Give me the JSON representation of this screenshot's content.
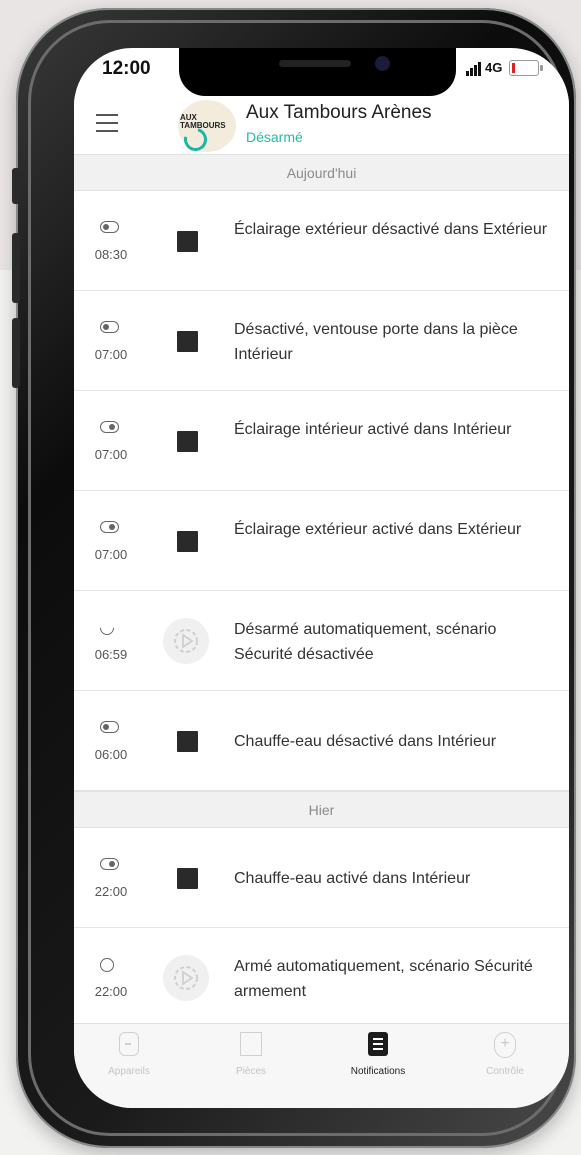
{
  "status_bar": {
    "time": "12:00",
    "network": "4G"
  },
  "header": {
    "site_name": "Aux Tambours Arènes",
    "site_status": "Désarmé",
    "logo_text": "AUX\nTAMBOURS",
    "status_color": "#23b9a7"
  },
  "sections": {
    "today": "Aujourd'hui",
    "yesterday": "Hier"
  },
  "notifications": [
    {
      "time": "08:30",
      "state_icon": "toggle-off-icon",
      "source_icon": "device-icon",
      "text": "Éclairage extérieur désactivé dans Extérieur"
    },
    {
      "time": "07:00",
      "state_icon": "toggle-off-icon",
      "source_icon": "device-icon",
      "text": "Désactivé, ventouse porte dans la pièce Intérieur"
    },
    {
      "time": "07:00",
      "state_icon": "toggle-on-icon",
      "source_icon": "device-icon",
      "text": "Éclairage intérieur activé dans Intérieur"
    },
    {
      "time": "07:00",
      "state_icon": "toggle-on-icon",
      "source_icon": "device-icon",
      "text": "Éclairage extérieur activé dans Extérieur"
    },
    {
      "time": "06:59",
      "state_icon": "disarm-icon",
      "source_icon": "scenario-gear-icon",
      "text": "Désarmé automatiquement, scénario Sécurité désactivée"
    },
    {
      "time": "06:00",
      "state_icon": "toggle-off-icon",
      "source_icon": "device-icon",
      "text": "Chauffe-eau désactivé dans Intérieur"
    },
    {
      "time": "22:00",
      "state_icon": "toggle-on-icon",
      "source_icon": "device-icon",
      "text": "Chauffe-eau activé dans Intérieur"
    },
    {
      "time": "22:00",
      "state_icon": "arm-icon",
      "source_icon": "scenario-gear-icon",
      "text": "Armé automatiquement, scénario Sécurité armement"
    }
  ],
  "tabs": {
    "devices": "Appareils",
    "rooms": "Pièces",
    "notifications": "Notifications",
    "control": "Contrôle",
    "active": "notifications"
  }
}
